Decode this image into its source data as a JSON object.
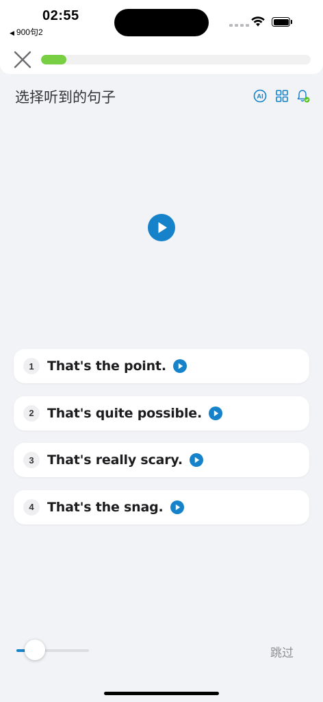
{
  "status_bar": {
    "time": "02:55",
    "back_app": "900句2"
  },
  "header": {
    "progress_percent": 9.5,
    "progress_color": "#78cf43"
  },
  "title": "选择听到的句子",
  "toolbar": {
    "ai_label": "AI"
  },
  "options": [
    {
      "number": "1",
      "text": "That's the point."
    },
    {
      "number": "2",
      "text": "That's quite possible."
    },
    {
      "number": "3",
      "text": "That's really scary."
    },
    {
      "number": "4",
      "text": "That's the snag."
    }
  ],
  "footer": {
    "speed_slider_value": 0.25,
    "skip_label": "跳过"
  },
  "colors": {
    "accent": "#1582c9",
    "progress": "#78cf43",
    "background": "#f2f3f7"
  }
}
